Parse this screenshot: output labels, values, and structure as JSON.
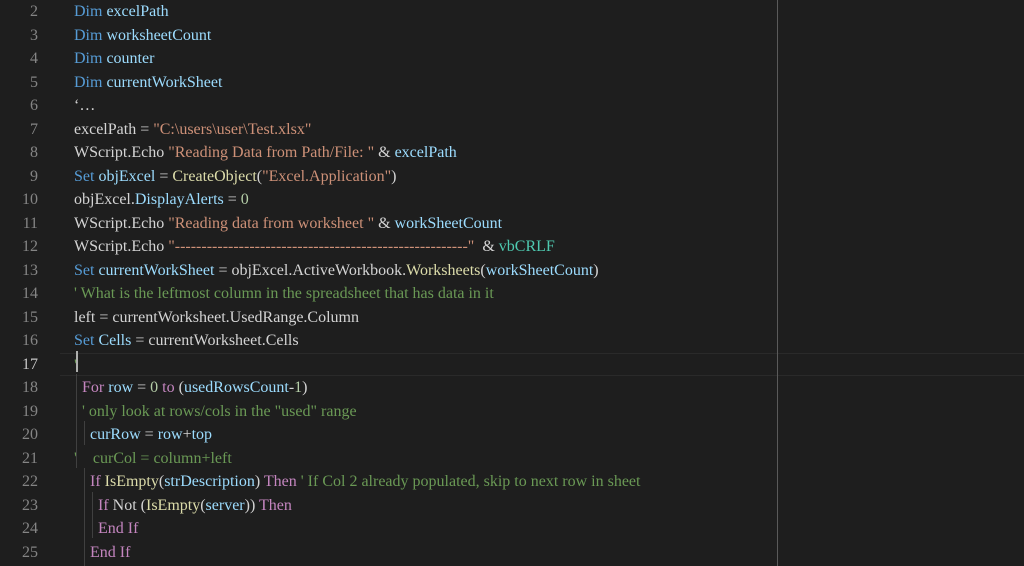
{
  "editor": {
    "current_line": 17,
    "lines": [
      {
        "n": "2",
        "tokens": [
          {
            "t": "Dim ",
            "c": "kw"
          },
          {
            "t": "excelPath",
            "c": "var"
          }
        ]
      },
      {
        "n": "3",
        "tokens": [
          {
            "t": "Dim ",
            "c": "kw"
          },
          {
            "t": "worksheetCount",
            "c": "var"
          }
        ]
      },
      {
        "n": "4",
        "tokens": [
          {
            "t": "Dim ",
            "c": "kw"
          },
          {
            "t": "counter",
            "c": "var"
          }
        ]
      },
      {
        "n": "5",
        "tokens": [
          {
            "t": "Dim ",
            "c": "kw"
          },
          {
            "t": "currentWorkSheet",
            "c": "var"
          }
        ]
      },
      {
        "n": "6",
        "tokens": [
          {
            "t": "‘…",
            "c": "def"
          }
        ]
      },
      {
        "n": "7",
        "tokens": [
          {
            "t": "excelPath = ",
            "c": "def"
          },
          {
            "t": "\"C:\\users\\user\\Test.xlsx\"",
            "c": "str"
          }
        ]
      },
      {
        "n": "8",
        "tokens": [
          {
            "t": "WScript.Echo ",
            "c": "def"
          },
          {
            "t": "\"Reading Data from Path/File: \"",
            "c": "str"
          },
          {
            "t": " & ",
            "c": "def"
          },
          {
            "t": "excelPath",
            "c": "var"
          }
        ]
      },
      {
        "n": "9",
        "tokens": [
          {
            "t": "Set ",
            "c": "kw"
          },
          {
            "t": "objExcel",
            "c": "var"
          },
          {
            "t": " = ",
            "c": "def"
          },
          {
            "t": "CreateObject",
            "c": "fn"
          },
          {
            "t": "(",
            "c": "def"
          },
          {
            "t": "\"Excel.Application\"",
            "c": "str"
          },
          {
            "t": ")",
            "c": "def"
          }
        ]
      },
      {
        "n": "10",
        "tokens": [
          {
            "t": "objExcel.",
            "c": "def"
          },
          {
            "t": "DisplayAlerts",
            "c": "var"
          },
          {
            "t": " = ",
            "c": "def"
          },
          {
            "t": "0",
            "c": "num"
          }
        ]
      },
      {
        "n": "11",
        "tokens": [
          {
            "t": "WScript.Echo ",
            "c": "def"
          },
          {
            "t": "\"Reading data from worksheet \"",
            "c": "str"
          },
          {
            "t": " & ",
            "c": "def"
          },
          {
            "t": "workSheetCount",
            "c": "var"
          }
        ]
      },
      {
        "n": "12",
        "tokens": [
          {
            "t": "WScript.Echo ",
            "c": "def"
          },
          {
            "t": "\"-------------------------------------------------------\"",
            "c": "str"
          },
          {
            "t": "  & ",
            "c": "def"
          },
          {
            "t": "vbCRLF",
            "c": "cls"
          }
        ]
      },
      {
        "n": "13",
        "tokens": [
          {
            "t": "Set ",
            "c": "kw"
          },
          {
            "t": "currentWorkSheet",
            "c": "var"
          },
          {
            "t": " = objExcel.ActiveWorkbook.",
            "c": "def"
          },
          {
            "t": "Worksheets",
            "c": "fn"
          },
          {
            "t": "(",
            "c": "def"
          },
          {
            "t": "workSheetCount",
            "c": "var"
          },
          {
            "t": ")",
            "c": "def"
          }
        ]
      },
      {
        "n": "14",
        "tokens": [
          {
            "t": "' What is the leftmost column in the spreadsheet that has data in it",
            "c": "cmt"
          }
        ]
      },
      {
        "n": "15",
        "tokens": [
          {
            "t": "left = currentWorksheet.UsedRange.Column",
            "c": "def"
          }
        ]
      },
      {
        "n": "16",
        "tokens": [
          {
            "t": "Set ",
            "c": "kw"
          },
          {
            "t": "Cells",
            "c": "var"
          },
          {
            "t": " = currentWorksheet.Cells",
            "c": "def"
          }
        ]
      },
      {
        "n": "17",
        "tokens": [
          {
            "t": "'",
            "c": "cmt"
          }
        ]
      },
      {
        "n": "18",
        "tokens": [
          {
            "t": "  For ",
            "c": "ctl"
          },
          {
            "t": "row",
            "c": "var"
          },
          {
            "t": " = ",
            "c": "def"
          },
          {
            "t": "0",
            "c": "num"
          },
          {
            "t": " to ",
            "c": "ctl"
          },
          {
            "t": "(",
            "c": "def"
          },
          {
            "t": "usedRowsCount",
            "c": "var"
          },
          {
            "t": "-",
            "c": "def"
          },
          {
            "t": "1",
            "c": "num"
          },
          {
            "t": ")",
            "c": "def"
          }
        ]
      },
      {
        "n": "19",
        "tokens": [
          {
            "t": "  ' only look at rows/cols in the \"used\" range",
            "c": "cmt"
          }
        ]
      },
      {
        "n": "20",
        "tokens": [
          {
            "t": "    ",
            "c": "def"
          },
          {
            "t": "curRow",
            "c": "var"
          },
          {
            "t": " = ",
            "c": "def"
          },
          {
            "t": "row",
            "c": "var"
          },
          {
            "t": "+",
            "c": "def"
          },
          {
            "t": "top",
            "c": "var"
          }
        ]
      },
      {
        "n": "21",
        "tokens": [
          {
            "t": "'    curCol = column+left",
            "c": "cmt"
          }
        ]
      },
      {
        "n": "22",
        "tokens": [
          {
            "t": "    If ",
            "c": "ctl"
          },
          {
            "t": "IsEmpty",
            "c": "fn"
          },
          {
            "t": "(",
            "c": "def"
          },
          {
            "t": "strDescription",
            "c": "var"
          },
          {
            "t": ") ",
            "c": "def"
          },
          {
            "t": "Then",
            "c": "ctl"
          },
          {
            "t": " ' If Col 2 already populated, skip to next row in sheet",
            "c": "cmt"
          }
        ]
      },
      {
        "n": "23",
        "tokens": [
          {
            "t": "      If ",
            "c": "ctl"
          },
          {
            "t": "Not (",
            "c": "def"
          },
          {
            "t": "IsEmpty",
            "c": "fn"
          },
          {
            "t": "(",
            "c": "def"
          },
          {
            "t": "server",
            "c": "var"
          },
          {
            "t": ")) ",
            "c": "def"
          },
          {
            "t": "Then",
            "c": "ctl"
          }
        ]
      },
      {
        "n": "24",
        "tokens": [
          {
            "t": "      End If",
            "c": "ctl"
          }
        ]
      },
      {
        "n": "25",
        "tokens": [
          {
            "t": "    End If",
            "c": "ctl"
          }
        ]
      }
    ]
  }
}
